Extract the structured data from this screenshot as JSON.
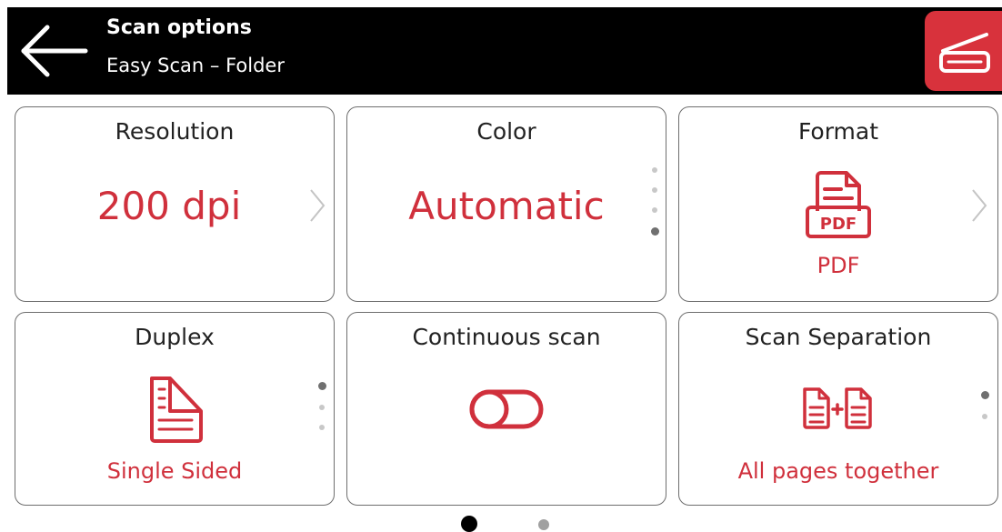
{
  "header": {
    "title": "Scan options",
    "subtitle": "Easy Scan – Folder",
    "back_icon": "arrow-left-icon",
    "scan_icon": "scanner-icon"
  },
  "colors": {
    "accent": "#d0303c",
    "header_bg": "#000000",
    "scan_button_bg": "#d8323c"
  },
  "tiles": {
    "resolution": {
      "label": "Resolution",
      "value": "200 dpi"
    },
    "color": {
      "label": "Color",
      "value": "Automatic"
    },
    "format": {
      "label": "Format",
      "value": "PDF",
      "icon_text": "PDF"
    },
    "duplex": {
      "label": "Duplex",
      "value": "Single Sided"
    },
    "continuous": {
      "label": "Continuous scan"
    },
    "separation": {
      "label": "Scan Separation",
      "value": "All pages together"
    }
  },
  "pagination": {
    "current_page": 1,
    "total_pages": 2
  }
}
